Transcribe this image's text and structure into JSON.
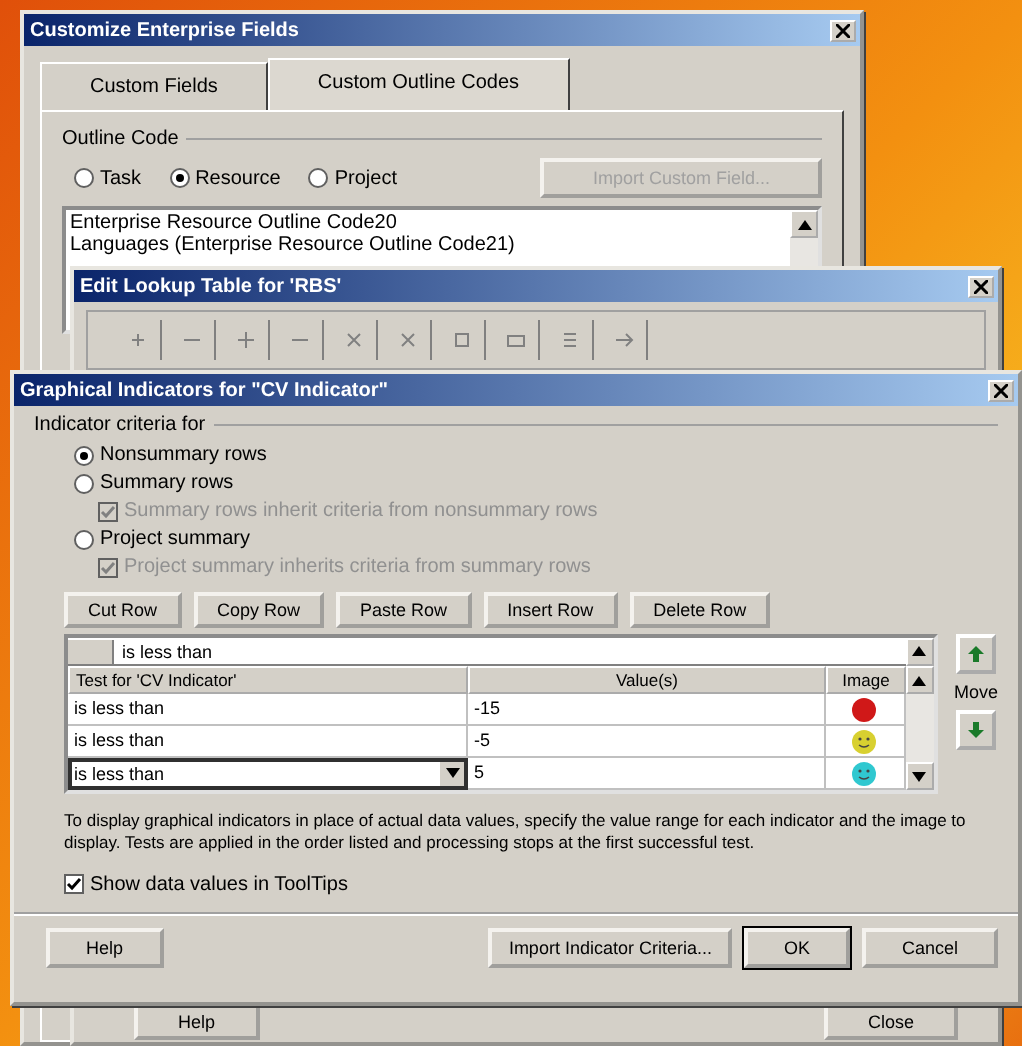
{
  "customize_window": {
    "title": "Customize Enterprise Fields",
    "tabs": [
      {
        "label": "Custom Fields",
        "selected": false
      },
      {
        "label": "Custom Outline Codes",
        "selected": true
      }
    ],
    "group_label": "Outline Code",
    "radios": [
      {
        "label": "Task",
        "selected": false
      },
      {
        "label": "Resource",
        "selected": true
      },
      {
        "label": "Project",
        "selected": false
      }
    ],
    "import_button": {
      "label": "Import Custom Field...",
      "disabled": true
    },
    "list_items": [
      "Enterprise Resource Outline Code20",
      "Languages (Enterprise Resource Outline Code21)"
    ]
  },
  "lookup_window": {
    "title": "Edit Lookup Table for 'RBS'",
    "buttons": [
      "Help",
      "Close"
    ]
  },
  "indicators_window": {
    "title": "Graphical Indicators for \"CV Indicator\"",
    "criteria_label": "Indicator criteria for",
    "options": [
      {
        "kind": "radio",
        "label": "Nonsummary rows",
        "selected": true,
        "disabled": false
      },
      {
        "kind": "radio",
        "label": "Summary rows",
        "selected": false,
        "disabled": false
      },
      {
        "kind": "checkbox",
        "label": "Summary rows inherit criteria from nonsummary rows",
        "checked": true,
        "disabled": true
      },
      {
        "kind": "radio",
        "label": "Project summary",
        "selected": false,
        "disabled": false
      },
      {
        "kind": "checkbox",
        "label": "Project summary inherits criteria from summary rows",
        "checked": true,
        "disabled": true
      }
    ],
    "row_buttons": [
      "Cut Row",
      "Copy Row",
      "Paste Row",
      "Insert Row",
      "Delete Row"
    ],
    "edit_value": "is less than",
    "columns": [
      "Test for 'CV Indicator'",
      "Value(s)",
      "Image"
    ],
    "rows": [
      {
        "test": "is less than",
        "value": "-15",
        "kind": "circle",
        "color": "#d01818",
        "selected": false
      },
      {
        "test": "is less than",
        "value": "-5",
        "kind": "smiley",
        "color": "#d8d030",
        "selected": false
      },
      {
        "test": "is less than",
        "value": "5",
        "kind": "smiley",
        "color": "#30c8d0",
        "selected": true
      }
    ],
    "move_label": "Move",
    "description": "To display graphical indicators in place of actual data values, specify the value range for each indicator and the image to display.  Tests are applied in the order listed and processing stops at the first successful test.",
    "tooltip_checkbox": {
      "label": "Show data values in ToolTips",
      "checked": true
    },
    "buttons": [
      {
        "label": "Help",
        "default": false
      },
      {
        "label": "Import Indicator Criteria...",
        "default": false
      },
      {
        "label": "OK",
        "default": true
      },
      {
        "label": "Cancel",
        "default": false
      }
    ]
  }
}
